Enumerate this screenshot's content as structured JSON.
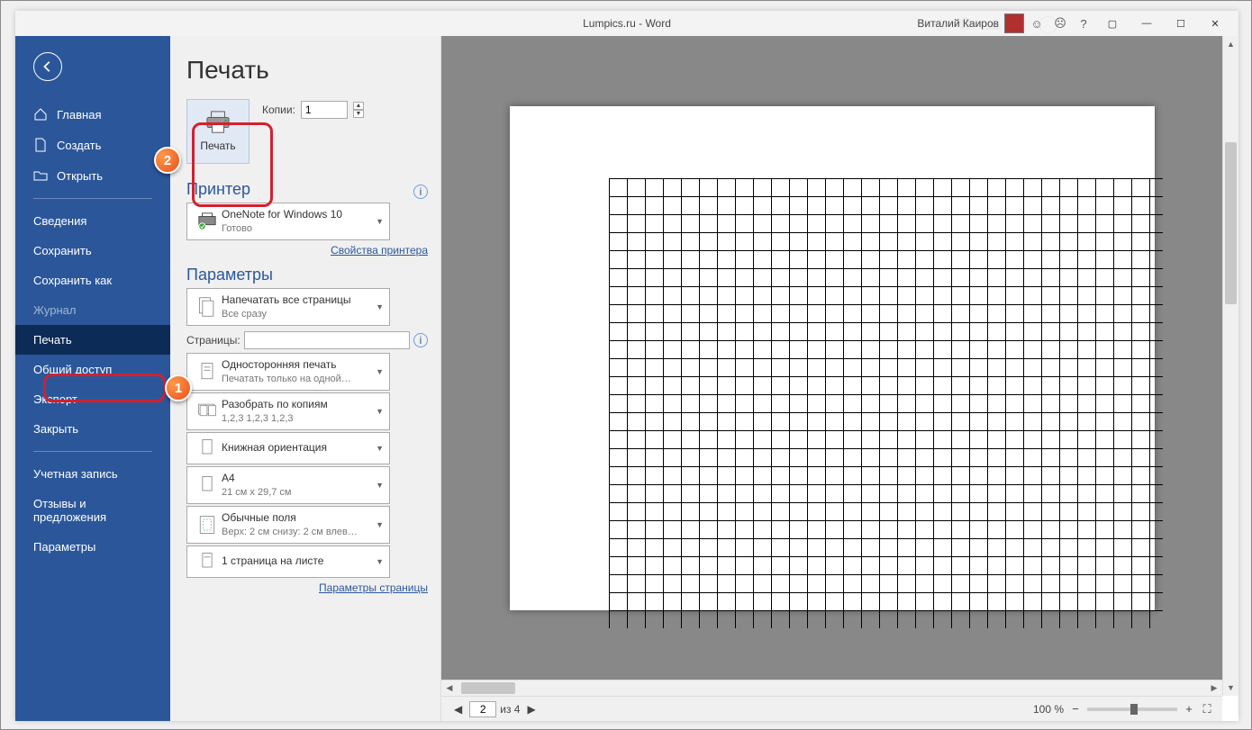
{
  "title_bar": {
    "document_title": "Lumpics.ru - Word",
    "user_name": "Виталий Каиров"
  },
  "sidebar": {
    "items": [
      {
        "icon": "home",
        "label": "Главная"
      },
      {
        "icon": "doc",
        "label": "Создать"
      },
      {
        "icon": "open",
        "label": "Открыть"
      }
    ],
    "items2": [
      {
        "label": "Сведения"
      },
      {
        "label": "Сохранить"
      },
      {
        "label": "Сохранить как"
      },
      {
        "label": "Журнал",
        "disabled": true
      },
      {
        "label": "Печать",
        "selected": true
      },
      {
        "label": "Общий доступ"
      },
      {
        "label": "Экспорт"
      },
      {
        "label": "Закрыть"
      }
    ],
    "items3": [
      {
        "label": "Учетная запись"
      },
      {
        "label": "Отзывы и предложения"
      },
      {
        "label": "Параметры"
      }
    ]
  },
  "print": {
    "page_title": "Печать",
    "button": "Печать",
    "copies_label": "Копии:",
    "copies_value": "1",
    "printer_header": "Принтер",
    "printer_name": "OneNote for Windows 10",
    "printer_status": "Готово",
    "printer_props": "Свойства принтера",
    "settings_header": "Параметры",
    "opt_print_all": "Напечатать все страницы",
    "opt_print_all_sub": "Все сразу",
    "pages_label": "Страницы:",
    "pages_value": "",
    "opt_sides": "Односторонняя печать",
    "opt_sides_sub": "Печатать только на одной…",
    "opt_collate": "Разобрать по копиям",
    "opt_collate_sub": "1,2,3    1,2,3    1,2,3",
    "opt_orient": "Книжная ориентация",
    "opt_paper": "A4",
    "opt_paper_sub": "21 см x 29,7 см",
    "opt_margins": "Обычные поля",
    "opt_margins_sub": "Верх: 2 см снизу: 2 см влев…",
    "opt_ppp": "1 страница на листе",
    "page_setup": "Параметры страницы"
  },
  "preview": {
    "current_page": "2",
    "total_pages": "из 4",
    "zoom": "100 %"
  }
}
